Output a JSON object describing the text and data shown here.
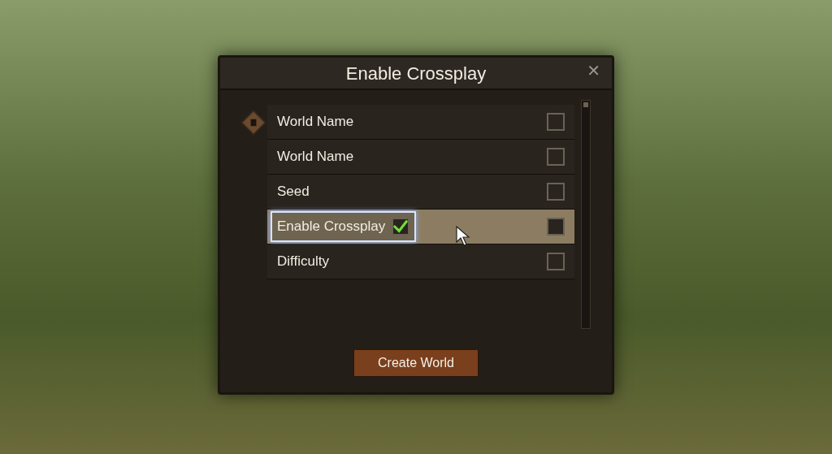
{
  "dialog": {
    "title": "Enable Crossplay",
    "close": "✕"
  },
  "rows": [
    {
      "label": "World Name",
      "selected": false,
      "checked": false,
      "marker": true
    },
    {
      "label": "World Name",
      "selected": false,
      "checked": false,
      "marker": false
    },
    {
      "label": "Seed",
      "selected": false,
      "checked": false,
      "marker": false
    },
    {
      "label": "Enable Crossplay",
      "selected": true,
      "checked": false,
      "marker": false,
      "toggle": {
        "checked": true
      }
    },
    {
      "label": "Difficulty",
      "selected": false,
      "checked": false,
      "marker": false
    }
  ],
  "button": "Create World"
}
